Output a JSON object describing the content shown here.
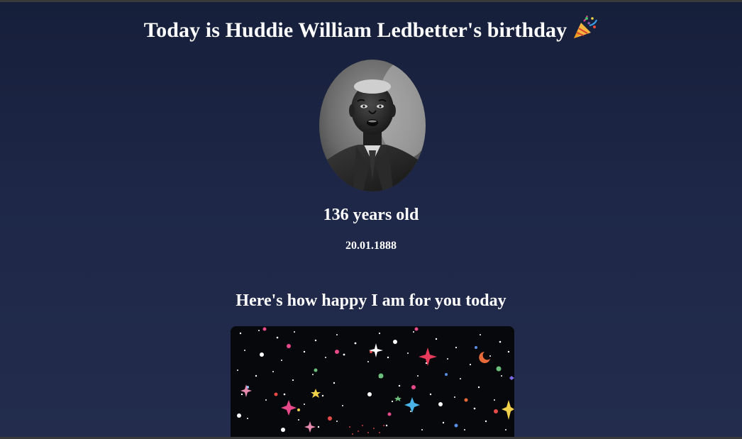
{
  "page": {
    "title": "Today is Huddie William Ledbetter's birthday",
    "title_icon": "party-popper-icon",
    "portrait_alt": "Huddie William Ledbetter",
    "age_text": "136 years old",
    "birth_date": "20.01.1888",
    "happy_heading": "Here's how happy I am for you today",
    "celebration_image": "starry-confetti-image"
  },
  "colors": {
    "background_top": "#161f3a",
    "background_bottom": "#232c4d",
    "text": "#ffffff",
    "image_background": "#07080c"
  }
}
